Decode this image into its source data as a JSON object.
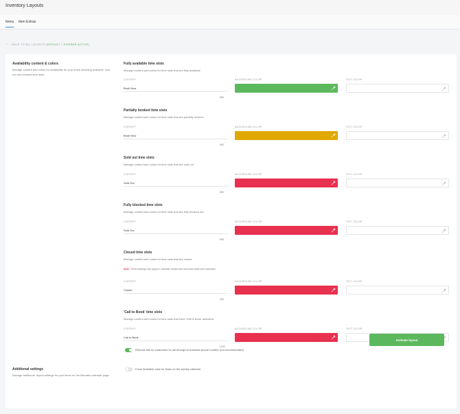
{
  "app": {
    "title": "Inventory Layouts"
  },
  "tabs": [
    {
      "label": "Items"
    },
    {
      "label": "Item Extras"
    }
  ],
  "back_link": {
    "prefix": "BACK TO ALL LAYOUTS",
    "highlight": "(DEFAULT + SIDEBAR ACTIVE)"
  },
  "sidebar": {
    "availability": {
      "title": "Availability content & colors",
      "description": "Manage content and colors for availability for your times including available, sold out and blocked time slots."
    },
    "additional": {
      "title": "Additional settings",
      "description": "Manage additional, layout settings for your items on the filterable calendar page."
    }
  },
  "field_labels": {
    "content": "CONTENT",
    "background": "BACKGROUND COLOR",
    "text": "TEXT COLOR",
    "required_mark": "*"
  },
  "sections": [
    {
      "title": "Fully available time slots",
      "description": "Manage content and colors for time slots that are fully available",
      "content": "Book Now",
      "counter": "8/30",
      "bg_color": "#5cb85c"
    },
    {
      "title": "Partially booked time slots",
      "description": "Manage content and colors for time slots that are partially booked.",
      "content": "Book Now",
      "counter": "8/30",
      "bg_color": "#e0a800"
    },
    {
      "title": "Sold out time slots",
      "description": "Manage content and colors for time slots that are sold out.",
      "content": "Sold Out",
      "counter": "8/30",
      "bg_color": "#e8304f"
    },
    {
      "title": "Fully blocked time slots",
      "description": "Manage content and colors for time slots that are fully blocked out.",
      "content": "Sold Out",
      "counter": "8/30",
      "bg_color": "#e8304f"
    },
    {
      "title": "Closed time slots",
      "description": "Manage content and colors for time slots that are closed.",
      "note_label": "Note:",
      "note": "These settings only apply to calendar modes that have time table view activated",
      "content": "Closed",
      "counter": "6/30",
      "bg_color": "#e8304f"
    },
    {
      "title": "'Call to Book' time slots",
      "description": "Manage content and colors for time slots that have 'Call to Book' activated.",
      "content": "Call to Book",
      "counter": "12/30",
      "bg_color": "#e8304f"
    }
  ],
  "toggles": {
    "remove_link": {
      "label": "Remove link for customers to call through to business phone number (not recommended)",
      "on": true
    },
    "force_timetable": {
      "label": "Force timetable view for times on the weekly calendar",
      "on": false
    }
  },
  "colors": {
    "toggle_on": "#5cb85c",
    "toggle_off": "#e3e4e7",
    "accent": "#3d8bd8",
    "required": "#e23d52"
  },
  "icons": {
    "color_picker": "eyedropper-icon",
    "back": "arrow-left-icon"
  },
  "actions": {
    "activate_label": "Activate layout"
  }
}
